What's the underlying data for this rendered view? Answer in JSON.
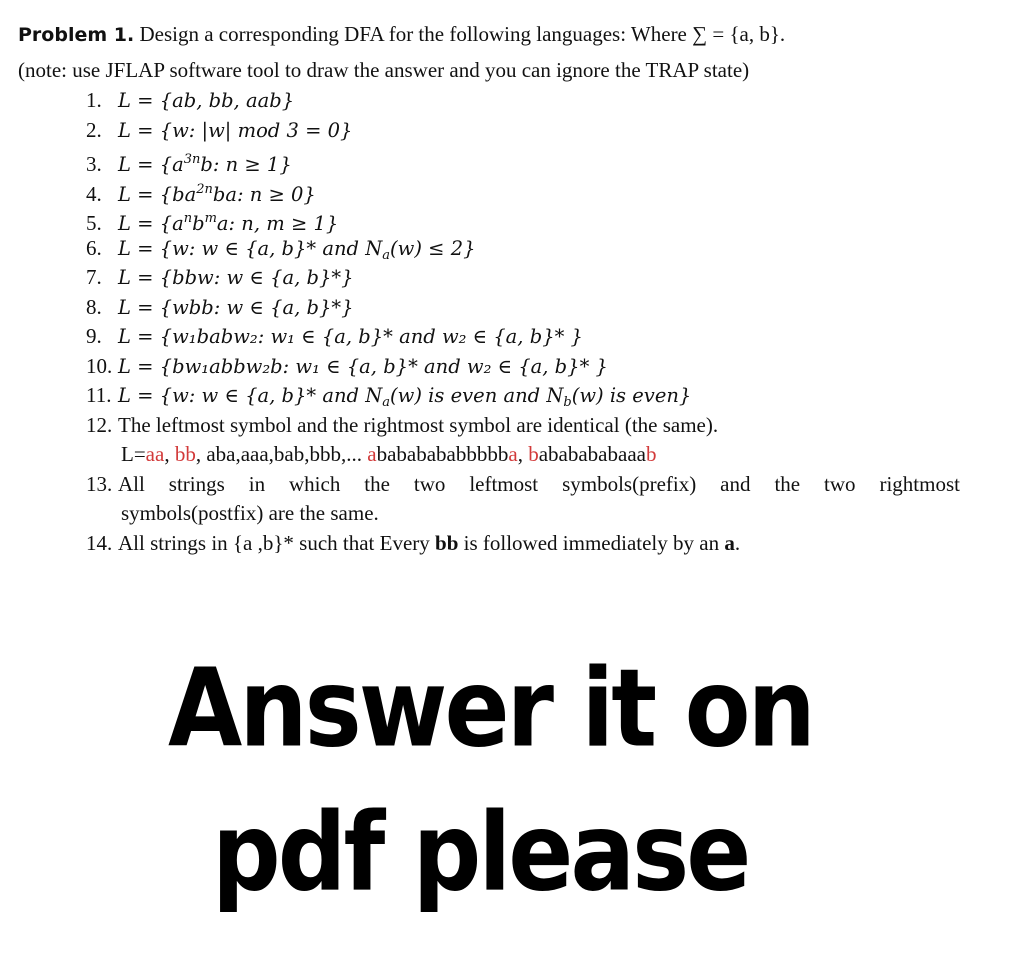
{
  "header": {
    "problem_label": "Problem 1.",
    "problem_text": " Design a corresponding DFA for the following languages: Where ∑ = {a, b}.",
    "note": "(note: use JFLAP software tool to draw the answer and you can ignore the TRAP state)"
  },
  "items": [
    {
      "num": "1.",
      "text": "L = {ab, bb, aab}"
    },
    {
      "num": "2.",
      "text": "L = {w: |w| mod 3 =  0}"
    },
    {
      "num": "3.",
      "pre": "L = {a",
      "sup": "3n",
      "post": "b: n ≥ 1}"
    },
    {
      "num": "4.",
      "pre": "L = {ba",
      "sup": "2n",
      "post": "ba: n ≥ 0}"
    },
    {
      "num": "5.",
      "pre": "L = {a",
      "sup": "n",
      "mid": "b",
      "sup2": "m",
      "post": "a: n, m ≥ 1}"
    },
    {
      "num": "6.",
      "pre": "L = {w: w ∈ {a, b}* and  N",
      "sub": "a",
      "post": "(w)  ≤ 2}"
    },
    {
      "num": "7.",
      "text": "L = {bbw: w ∈ {a, b}*}"
    },
    {
      "num": "8.",
      "text": "L = {wbb: w ∈ {a, b}*}"
    },
    {
      "num": "9.",
      "text": "L = {w₁babw₂: w₁ ∈ {a, b}* and w₂  ∈ {a, b}* }"
    },
    {
      "num": "10.",
      "text": "L = {bw₁abbw₂b: w₁ ∈ {a, b}* and w₂  ∈ {a, b}* }"
    },
    {
      "num": "11.",
      "pre": "L = {w: w ∈ {a, b}* and  N",
      "sub": "a",
      "mid": "(w)  is even and N",
      "sub2": "b",
      "post": "(w) is even}"
    },
    {
      "num": "12.",
      "text": "The leftmost symbol and the rightmost symbol are identical (the same)."
    },
    {
      "num": "13.",
      "text": "All strings in which the two leftmost symbols(prefix) and the two rightmost",
      "cont": "symbols(postfix) are the same."
    },
    {
      "num": "14.",
      "pre": "All strings in {a ,b}* such that Every ",
      "bold1": "bb",
      "mid": " is followed immediately by an ",
      "bold2": "a",
      "post": "."
    }
  ],
  "example_line": {
    "prefix": "L=",
    "red1": "aa",
    "sep1": ", ",
    "red2": "bb",
    "middle": ", aba,aaa,bab,bbb,... ",
    "red3": "a",
    "plain3": "babababab bbbb",
    "red4": "a",
    "sep4": ", ",
    "red5": "b",
    "plain5": "abababab aaa",
    "red6": "b"
  },
  "overlay": {
    "line1": "Answer it on",
    "line2": "pdf please"
  },
  "colors": {
    "highlight_red": "#d23a3a",
    "text": "#111111",
    "background": "#ffffff"
  }
}
